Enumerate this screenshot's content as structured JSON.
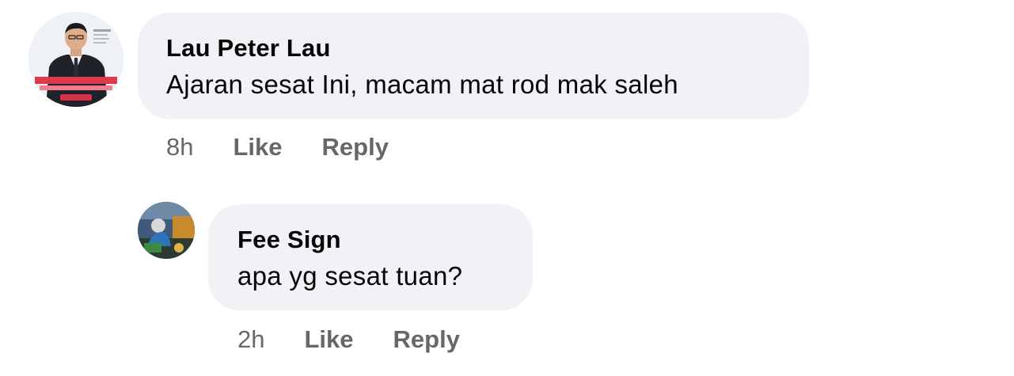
{
  "comments": [
    {
      "author": "Lau Peter Lau",
      "text": "Ajaran sesat Ini, macam mat rod mak saleh",
      "time": "8h",
      "like_label": "Like",
      "reply_label": "Reply"
    },
    {
      "author": "Fee Sign",
      "text": "apa yg sesat tuan?",
      "time": "2h",
      "like_label": "Like",
      "reply_label": "Reply"
    }
  ],
  "colors": {
    "bubble_bg": "#f0f2f5",
    "meta_text": "#65676b",
    "primary_text": "#050505"
  }
}
